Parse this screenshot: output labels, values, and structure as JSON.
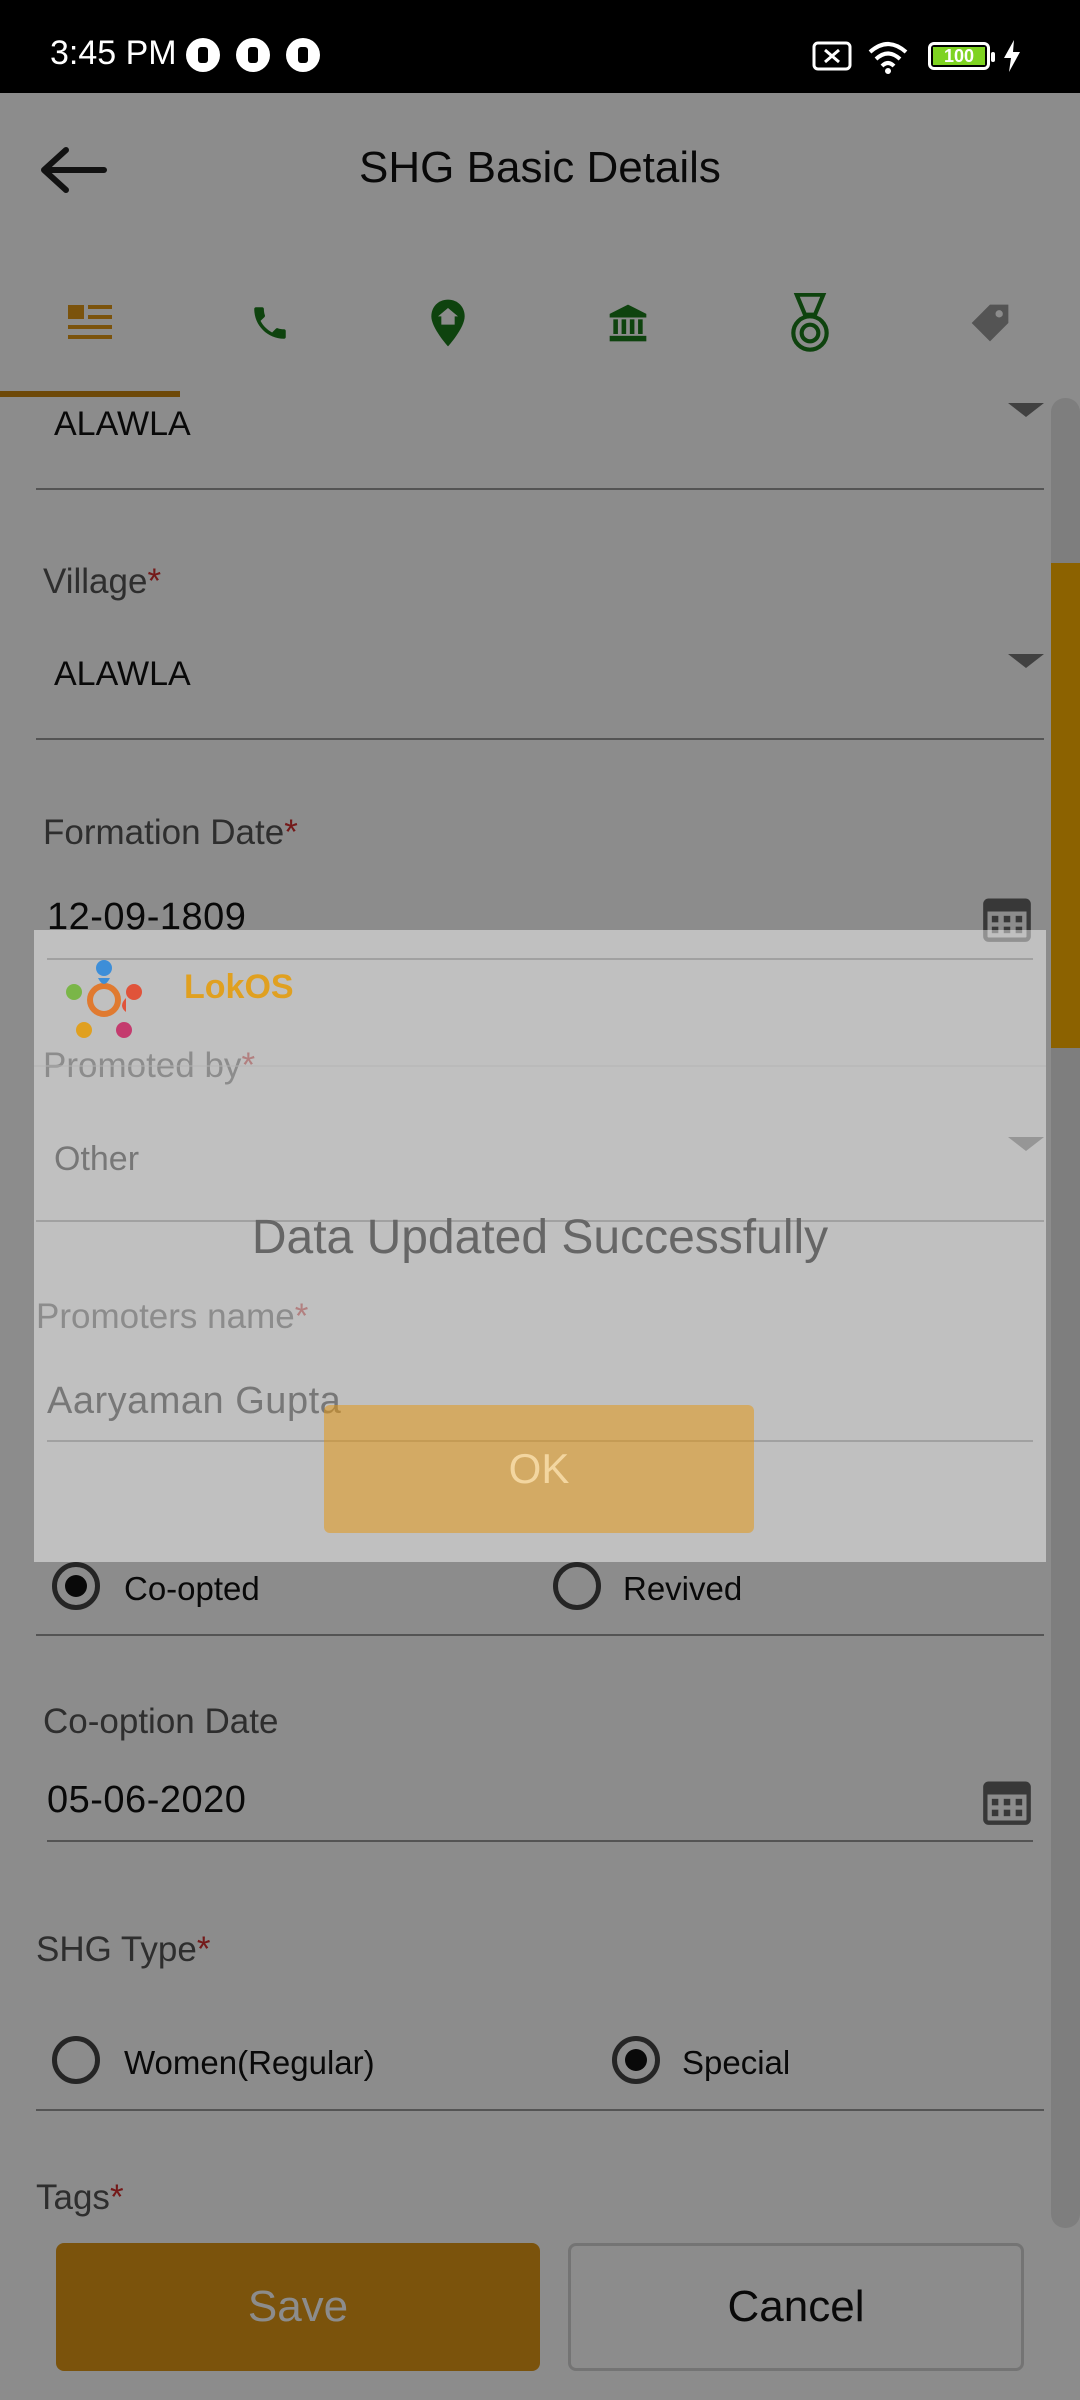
{
  "status_bar": {
    "time": "3:45 PM",
    "battery": "100"
  },
  "app_bar": {
    "title": "SHG Basic Details",
    "back_icon": "arrow-left-icon"
  },
  "tabs": [
    {
      "icon": "list-icon",
      "active": true
    },
    {
      "icon": "phone-icon"
    },
    {
      "icon": "location-home-icon"
    },
    {
      "icon": "bank-icon"
    },
    {
      "icon": "medal-icon"
    },
    {
      "icon": "tag-icon"
    }
  ],
  "form": {
    "top_value": "ALAWLA",
    "village": {
      "label": "Village",
      "required_mark": "*",
      "value": "ALAWLA"
    },
    "formation_date": {
      "label": "Formation Date",
      "required_mark": "*",
      "value": "12-09-1809"
    },
    "promoted_by": {
      "label": "Promoted by",
      "required_mark": "*",
      "value": "Other"
    },
    "promoters_name": {
      "label": "Promoters name",
      "required_mark": "*",
      "value": "Aaryaman Gupta"
    },
    "status_radio": [
      {
        "label": "Co-opted",
        "selected": true
      },
      {
        "label": "Revived",
        "selected": false
      }
    ],
    "co_option_date": {
      "label": "Co-option Date",
      "value": "05-06-2020"
    },
    "shg_type": {
      "label": "SHG Type",
      "required_mark": "*",
      "options": [
        {
          "label": "Women(Regular)",
          "selected": false
        },
        {
          "label": "Special",
          "selected": true
        }
      ]
    },
    "tags": {
      "label": "Tags",
      "required_mark": "*"
    }
  },
  "buttons": {
    "save": "Save",
    "cancel": "Cancel"
  },
  "dialog": {
    "brand": "LokOS",
    "message": "Data Updated Successfully",
    "ok": "OK"
  },
  "colors": {
    "accent": "#e19817",
    "tab_icon_green": "#1b7a1b",
    "required": "#d32f2f"
  }
}
